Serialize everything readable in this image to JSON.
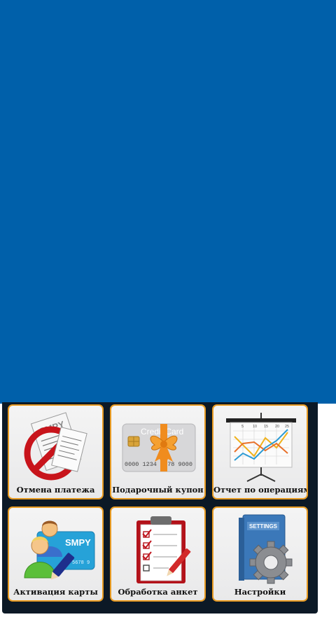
{
  "menu": {
    "tiles": [
      {
        "label": "Отмена платежа",
        "icon": "cancel-payment-icon",
        "icon_text": "SMPY"
      },
      {
        "label": "Подарочный купон",
        "icon": "gift-card-icon",
        "icon_text": "Credit Card",
        "card_number": "0000 1234 5678 9000"
      },
      {
        "label": "Отчет по операциям",
        "icon": "report-chart-icon",
        "axis_ticks": [
          "5",
          "10",
          "15",
          "20",
          "25"
        ]
      },
      {
        "label": "Активация карты",
        "icon": "card-activation-icon",
        "icon_text": "SMPY",
        "card_number": "5678 9"
      },
      {
        "label": "Обработка анкет",
        "icon": "questionnaire-clipboard-icon"
      },
      {
        "label": "Настройки",
        "icon": "settings-gear-icon",
        "icon_text": "SETTINGS"
      }
    ]
  },
  "colors": {
    "header_blue": "#0060aa",
    "menu_background": "#0c1926",
    "tile_border": "#e89b22",
    "tile_background": "#efeff0"
  }
}
